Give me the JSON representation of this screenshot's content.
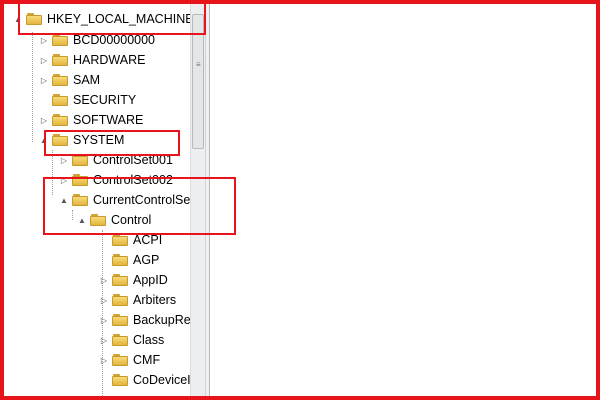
{
  "tree": {
    "root": {
      "label": "HKEY_LOCAL_MACHINE",
      "expander": "▲"
    },
    "hive_children": [
      {
        "label": "BCD00000000",
        "expander": "▷"
      },
      {
        "label": "HARDWARE",
        "expander": "▷"
      },
      {
        "label": "SAM",
        "expander": "▷"
      },
      {
        "label": "SECURITY",
        "expander": ""
      },
      {
        "label": "SOFTWARE",
        "expander": "▷"
      },
      {
        "label": "SYSTEM",
        "expander": "▲"
      }
    ],
    "system_children": [
      {
        "label": "ControlSet001",
        "expander": "▷"
      },
      {
        "label": "ControlSet002",
        "expander": "▷"
      },
      {
        "label": "CurrentControlSe",
        "expander": "▲"
      }
    ],
    "current_children": [
      {
        "label": "Control",
        "expander": "▲"
      }
    ],
    "control_children": [
      {
        "label": "ACPI",
        "expander": ""
      },
      {
        "label": "AGP",
        "expander": ""
      },
      {
        "label": "AppID",
        "expander": "▷"
      },
      {
        "label": "Arbiters",
        "expander": "▷"
      },
      {
        "label": "BackupRe",
        "expander": "▷"
      },
      {
        "label": "Class",
        "expander": "▷"
      },
      {
        "label": "CMF",
        "expander": "▷"
      },
      {
        "label": "CoDeviceI",
        "expander": ""
      }
    ]
  },
  "scrollbar": {
    "grip": "≡"
  },
  "colors": {
    "highlight": "#e8141c",
    "folder": "#f2c75c"
  }
}
